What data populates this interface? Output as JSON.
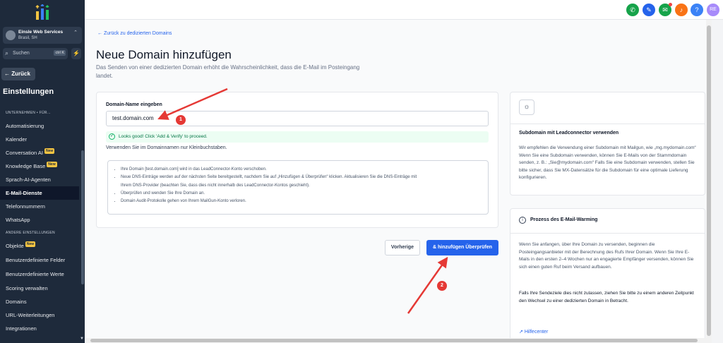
{
  "sidebar": {
    "account_name": "Einsle Web Services",
    "account_location": "Brasil, SH",
    "search_placeholder": "Suchen",
    "search_shortcut": "ctrl K",
    "back_label": "← Zurück",
    "settings_title": "Einstellungen",
    "section_company": "UNTERNEHMEN  •  FÜR…",
    "section_other": "ANDERE EINSTELLUNGEN",
    "new_badge": "New",
    "items": [
      {
        "label": "Automatisierung"
      },
      {
        "label": "Kalender"
      },
      {
        "label": "Conversation AI"
      },
      {
        "label": "Knowledge Base"
      },
      {
        "label": "Sprach-AI-Agenten"
      },
      {
        "label": "E-Mail-Dienste"
      },
      {
        "label": "Telefonnummern"
      },
      {
        "label": "WhatsApp"
      },
      {
        "label": "Objekte"
      },
      {
        "label": "Benutzerdefinierte Felder"
      },
      {
        "label": "Benutzerdefinierte Werte"
      },
      {
        "label": "Scoring verwalten"
      },
      {
        "label": "Domains"
      },
      {
        "label": "URL-Weiterleitungen"
      },
      {
        "label": "Integrationen"
      }
    ]
  },
  "topbar": {
    "avatar_initials": "RE",
    "colors": {
      "phone": "#16a34a",
      "megaphone": "#2563eb",
      "chat": "#16a34a",
      "bell": "#f97316",
      "help": "#3b82f6",
      "avatar": "#a78bfa"
    }
  },
  "main": {
    "breadcrumb": "←  Zurück zu dedizierten Domains",
    "title": "Neue Domain hinzufügen",
    "subtitle": "Das Senden von einer dedizierten Domain erhöht die Wahrscheinlichkeit, dass die E-Mail im Posteingang landet.",
    "domain_label": "Domain-Name eingeben",
    "domain_value": "test.domain.com",
    "success_msg": "Looks good! Click 'Add & Verify' to proceed.",
    "hint": "Verwenden Sie im Domainnamen nur Kleinbuchstaben.",
    "notes": [
      "Ihre Domain [test.domain.com] wird in das LeadConnector-Konto verschoben.",
      "Neue DNS-Einträge werden auf der nächsten Seite bereitgestellt, nachdem Sie auf „Hinzufügen & Überprüfen“ klicken. Aktualisieren Sie die DNS-Einträge mit",
      "Ihrem DNS-Provider (beachten Sie, dass dies nicht innerhalb des LeadConnector-Kontos geschieht).",
      "Überprüfen und wenden Sie Ihre Domain an.",
      "Domain Audit-Protokolle gehen von Ihrem MailGun-Konto verloren."
    ],
    "btn_prev": "Vorherige",
    "btn_add": "& hinzufügen Überprüfen"
  },
  "panel_subdomain": {
    "title": "Subdomain mit Leadconnector verwenden",
    "body": "Wir empfehlen die Verwendung einer Subdomain mit Mailgun, wie „mg.mydomain.com“ Wenn Sie eine Subdomain verwenden, können Sie E-Mails von der Stammdomain senden, z. B.: „Sie@mydomain.com“ Falls Sie eine Subdomain verwenden, stellen Sie bitte sicher, dass Sie MX-Datensätze für die Subdomain für eine optimale Lieferung konfigurieren."
  },
  "panel_warming": {
    "title": "Prozess des E-Mail-Warming",
    "body1": "Wenn Sie anfangen, über Ihre Domain zu versenden, beginnen die Posteingangsanbieter mit der Berechnung des Rufs Ihrer Domain. Wenn Sie Ihre E-Mails in den ersten 2–4 Wochen nur an engagierte Empfänger versenden, können Sie sich einen guten Ruf beim Versand aufbauen.",
    "body2": "Falls Ihre Sendeziele dies nicht zulassen, ziehen Sie bitte zu einem anderen Zeitpunkt den Wechsel zu einer dedizierten Domain in Betracht.",
    "help": "Hilfecenter"
  },
  "annotations": {
    "n1": "1",
    "n2": "2",
    "color": "#e53935"
  }
}
